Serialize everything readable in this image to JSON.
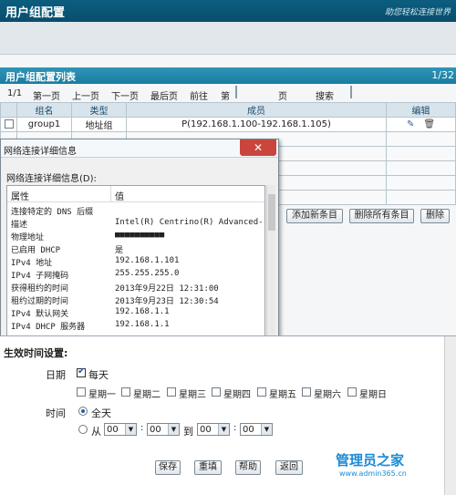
{
  "header": {
    "title": "用户组配置",
    "logo": "助您轻松连接世界"
  },
  "list": {
    "title": "用户组配置列表",
    "page": "1/32",
    "nav_page": "1/1",
    "first": "第一页",
    "prev": "上一页",
    "next": "下一页",
    "last": "最后页",
    "goto": "前往",
    "di": "第",
    "ye": "页",
    "search": "搜索"
  },
  "table": {
    "headers": [
      "组名",
      "类型",
      "成员",
      "编辑"
    ],
    "row": {
      "name": "group1",
      "type": "地址组",
      "members": "P(192.168.1.100-192.168.1.105)"
    }
  },
  "buttons": {
    "add": "添加新条目",
    "delete_all": "删除所有条目",
    "delete": "删除"
  },
  "dialog": {
    "title": "网络连接详细信息",
    "label": "网络连接详细信息(D):",
    "close": "✕",
    "col_prop": "属性",
    "col_val": "值",
    "rows": [
      {
        "p": "连接特定的 DNS 后缀",
        "v": ""
      },
      {
        "p": "描述",
        "v": "Intel(R) Centrino(R) Advanced-"
      },
      {
        "p": "物理地址",
        "v": "■■■■■■■■■■"
      },
      {
        "p": "已启用 DHCP",
        "v": "是"
      },
      {
        "p": "IPv4 地址",
        "v": "192.168.1.101"
      },
      {
        "p": "IPv4 子网掩码",
        "v": "255.255.255.0"
      },
      {
        "p": "获得租约的时间",
        "v": "2013年9月22日 12:31:00"
      },
      {
        "p": "租约过期的时间",
        "v": "2013年9月23日 12:30:54"
      },
      {
        "p": "IPv4 默认网关",
        "v": "192.168.1.1"
      },
      {
        "p": "IPv4 DHCP 服务器",
        "v": "192.168.1.1"
      }
    ]
  },
  "schedule": {
    "title": "生效时间设置:",
    "date": "日期",
    "everyday": "每天",
    "days": [
      "星期一",
      "星期二",
      "星期三",
      "星期四",
      "星期五",
      "星期六",
      "星期日"
    ],
    "time": "时间",
    "allday": "全天",
    "from": "从",
    "to": "到",
    "h1": "00",
    "m1": "00",
    "h2": "00",
    "m2": "00",
    "save": "保存",
    "reset": "重填",
    "help": "帮助",
    "back": "返回"
  },
  "watermark": {
    "site": "管理员之家",
    "url": "www.admin365.cn"
  }
}
